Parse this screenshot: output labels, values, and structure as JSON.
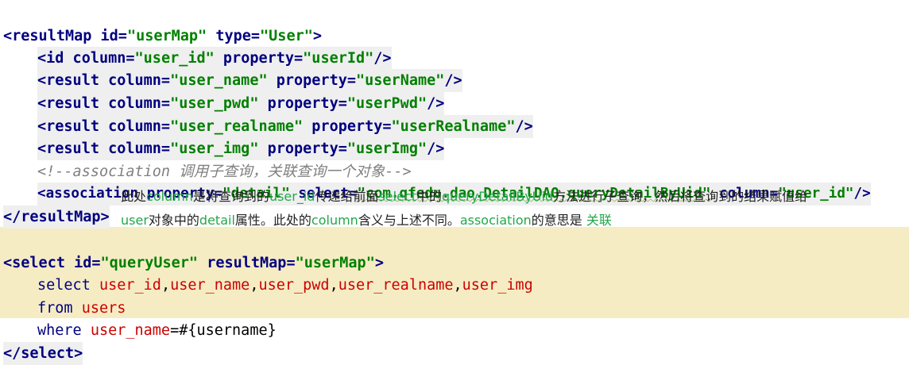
{
  "code": {
    "result_map_open": {
      "tag": "<resultMap",
      "a1": " id=",
      "v1": "\"userMap\"",
      "a2": " type=",
      "v2": "\"User\"",
      "end": ">"
    },
    "id_line": {
      "tag": "<id",
      "a1": " column=",
      "v1": "\"user_id\"",
      "a2": " property=",
      "v2": "\"userId\"",
      "end": "/>"
    },
    "result_name": {
      "tag": "<result",
      "a1": " column=",
      "v1": "\"user_name\"",
      "a2": " property=",
      "v2": "\"userName\"",
      "end": "/>"
    },
    "result_pwd": {
      "tag": "<result",
      "a1": " column=",
      "v1": "\"user_pwd\"",
      "a2": " property=",
      "v2": "\"userPwd\"",
      "end": "/>"
    },
    "result_realname": {
      "tag": "<result",
      "a1": " column=",
      "v1": "\"user_realname\"",
      "a2": " property=",
      "v2": "\"userRealname\"",
      "end": "/>"
    },
    "result_img": {
      "tag": "<result",
      "a1": " column=",
      "v1": "\"user_img\"",
      "a2": " property=",
      "v2": "\"userImg\"",
      "end": "/>"
    },
    "comment": "<!--association 调用子查询，关联查询一个对象-->",
    "association": {
      "tag": "<association",
      "a1": " property=",
      "v1": "\"detail\"",
      "a2": " select=",
      "v2": "\"com.qfedu.dao.DetailDAO.queryDetailByUid\"",
      "a3": " column=",
      "v3": "\"user_id\"",
      "end": "/>"
    },
    "result_map_close": "</resultMap>",
    "select_open": {
      "tag": "<select",
      "a1": " id=",
      "v1": "\"queryUser\"",
      "a2": " resultMap=",
      "v2": "\"userMap\"",
      "end": ">"
    },
    "sql_select": {
      "kw": "select ",
      "c1": "user_id",
      "c2": "user_name",
      "c3": "user_pwd",
      "c4": "user_realname",
      "c5": "user_img",
      "sep": ","
    },
    "sql_from": {
      "kw": "from ",
      "table": "users"
    },
    "sql_where": {
      "kw": "where ",
      "col": "user_name",
      "rest": "=#{username}"
    },
    "select_close": "</select>"
  },
  "note": {
    "line1": {
      "t1": "此处",
      "g1": "column",
      "t2": "是将查询到的",
      "g2": "user_id",
      "t3": "传递给前面",
      "g3": "select",
      "t4": "中的",
      "g4": "queryDetailByUid",
      "t5": "方法进行子查询，然后将查询到的结果赋值给"
    },
    "line2": {
      "g1": "user",
      "t1": "对象中的",
      "g2": "detail",
      "t2": "属性。此处的",
      "g3": "column",
      "t3": "含义与上述不同。",
      "g4": "association",
      "t4": "的意思是 ",
      "g5": "关联"
    }
  },
  "colors": {
    "keyword": "#000080",
    "string": "#008000",
    "comment": "#808080",
    "sql_ident": "#cc0000",
    "note_green": "#22a84a",
    "select_band": "#f6ecc4"
  }
}
